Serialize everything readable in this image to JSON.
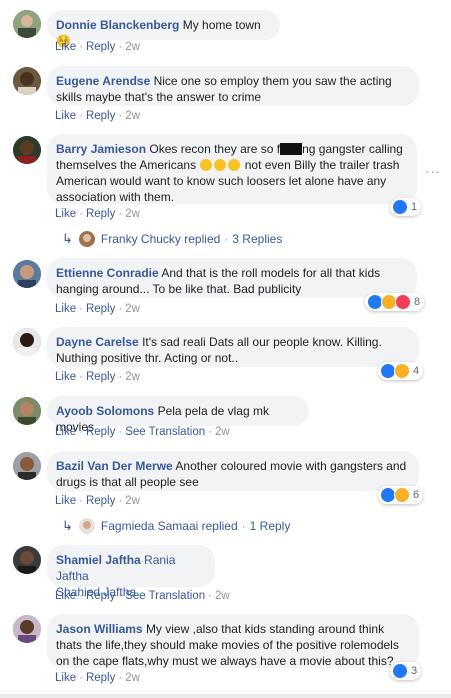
{
  "common": {
    "like": "Like",
    "reply": "Reply",
    "see_translation": "See Translation",
    "sep": "·",
    "more": "···"
  },
  "comments": [
    {
      "author": "Donnie Blanckenberg",
      "text": "My home town☺️",
      "time": "2w"
    },
    {
      "author": "Eugene Arendse",
      "text": "Nice one so employ them you saw the acting skills maybe that's the answer to crime",
      "time": "2w"
    },
    {
      "author": "Barry Jamieson",
      "text_a": "Okes recon they are so f",
      "text_b": "ng gangster calling themselves the Americans",
      "text_c": " not even Billy the trailer trash American would want to know such loosers let alone have any association with them.",
      "time": "2w",
      "reactions": "1",
      "replier": "Franky Chucky replied",
      "reply_count": "3 Replies"
    },
    {
      "author": "Ettienne Conradie",
      "text": "And that is the roll models for all that kids hanging around... To be like that. Bad publicity",
      "time": "2w",
      "reactions": "8"
    },
    {
      "author": "Dayne Carelse",
      "text": "It's sad reali Dats all our people know. Killing. Nuthing positive thr. Acting or not..",
      "time": "2w",
      "reactions": "4"
    },
    {
      "author": "Ayoob Solomons",
      "text": "Pela pela de vlag mk movies",
      "time": "2w"
    },
    {
      "author": "Bazil Van Der Merwe",
      "text": "Another coloured movie with gangsters and drugs is that all people see",
      "time": "2w",
      "reactions": "6",
      "replier": "Fagmieda Samaai replied",
      "reply_count": "1 Reply"
    },
    {
      "author": "Shamiel Jaftha",
      "text": "Rania Jaftha",
      "tagged": "Shahied Jaftha",
      "time": "2w"
    },
    {
      "author": "Jason Williams",
      "text": "My view ,also that kids standing around think thats the life,they should make movies of the positive rolemodels on the cape flats,why must we always have a movie about this?",
      "time": "2w",
      "reactions": "3"
    }
  ],
  "colors": {
    "link": "#385898",
    "bubble": "#f2f3f5",
    "like": "#2078f4",
    "sad": "#f7b125",
    "love": "#f33e58"
  }
}
